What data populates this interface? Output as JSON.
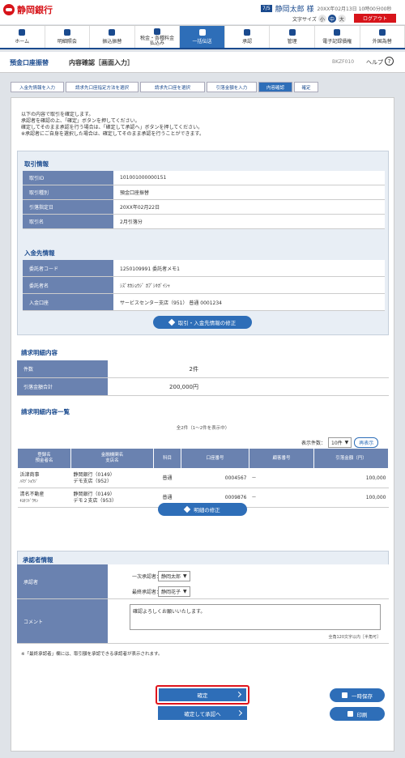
{
  "bank_name": "静岡銀行",
  "user": {
    "badge": "7/5",
    "name": "静岡太郎 様",
    "last_login": "20XX年02月13日 10時00分00秒",
    "font_size_label": "文字サイズ",
    "font_sizes": [
      "小",
      "中",
      "大"
    ],
    "logout": "ログアウト"
  },
  "nav": [
    {
      "label": "ホーム",
      "icon": "home-icon"
    },
    {
      "label": "明細照会",
      "icon": "document-icon"
    },
    {
      "label": "振込振替",
      "icon": "transfer-icon"
    },
    {
      "label": "税金・各種料金\n払込み",
      "icon": "tax-icon"
    },
    {
      "label": "一括伝送",
      "icon": "bulk-icon"
    },
    {
      "label": "承認",
      "icon": "approve-icon"
    },
    {
      "label": "管理",
      "icon": "admin-icon"
    },
    {
      "label": "電子記録債権",
      "icon": "erecord-icon"
    },
    {
      "label": "外国為替",
      "icon": "forex-icon"
    }
  ],
  "page": {
    "service": "預金口座振替",
    "title": "内容確認［画面入力］",
    "code": "BKZF010",
    "help": "ヘルプ",
    "help_icon": "?"
  },
  "steps": [
    "入金先情報を入力",
    "請求先口座指定方法を選択",
    "請求先口座を選択",
    "引落金額を入力",
    "内容確認",
    "確定"
  ],
  "intro": [
    "以下の内容で取引を確定します。",
    "承認者を確認の上、「確定」ボタンを押してください。",
    "確定してそのまま承認を行う場合は、「確定して承認へ」ボタンを押してください。",
    "※承認者にご自身を選択した場合は、確定してそのまま承認を行うことができます。"
  ],
  "transaction": {
    "heading": "取引情報",
    "rows": [
      {
        "k": "取引ID",
        "v": "101001000000151"
      },
      {
        "k": "取引種別",
        "v": "預金口座振替"
      },
      {
        "k": "引落指定日",
        "v": "20XX年02月22日"
      },
      {
        "k": "取引名",
        "v": "2月引落分"
      }
    ]
  },
  "deposit": {
    "heading": "入金先情報",
    "rows": [
      {
        "k": "委託者コード",
        "v": "1250109991 委託者メモ1"
      },
      {
        "k": "委託者名",
        "v": "ｼｽﾞｵｶｼｮｳｼﾞ ｶﾌﾞｼｷｶﾞｲｼｬ"
      },
      {
        "k": "入金口座",
        "v": "サービスセンター支店（951） 普通 0001234"
      }
    ],
    "edit_button": "取引・入金先情報の修正"
  },
  "summary": {
    "heading": "請求明細内容",
    "rows": [
      {
        "k": "件数",
        "v": "2件"
      },
      {
        "k": "引落金額合計",
        "v": "200,000円"
      }
    ]
  },
  "list": {
    "heading": "請求明細内容一覧",
    "count": "全2件（1～2件を表示中）",
    "display_label": "表示件数：",
    "display_value": "10件",
    "redisplay": "再表示",
    "columns": [
      "登録名\n預金者名",
      "金融機関名\n支店名",
      "科目",
      "口座番号",
      "顧客番号",
      "引落金額（円）"
    ],
    "rows": [
      {
        "reg": "浜津商事",
        "kana": "ﾊﾏﾂﾞｼｮｳｼﾞ",
        "bank": "静岡銀行（0149）",
        "branch": "デモ支店（952）",
        "type": "普通",
        "acct": "0004567",
        "cust": "－",
        "amount": "100,000"
      },
      {
        "reg": "清名不動産",
        "kana": "ｷﾖﾅﾌﾄﾞｳｻﾝ",
        "bank": "静岡銀行（0149）",
        "branch": "デモ２支店（953）",
        "type": "普通",
        "acct": "0009876",
        "cust": "－",
        "amount": "100,000"
      }
    ],
    "edit_button": "明細の修正"
  },
  "approver": {
    "heading": "承認者情報",
    "label": "承認者",
    "first_label": "一次承認者：",
    "first_value": "静岡太郎",
    "final_label": "最終承認者：",
    "final_value": "静岡花子",
    "comment_label": "コメント",
    "comment": "確認よろしくお願いいたします。",
    "comment_limit": "全角120文字以内［半角可］"
  },
  "note": "※「最終承認者」欄には、取引額を承認できる承認者が表示されます。",
  "buttons": {
    "confirm": "確定",
    "confirm_approve": "確定して承認へ",
    "save": "一時保存",
    "print": "印刷"
  }
}
